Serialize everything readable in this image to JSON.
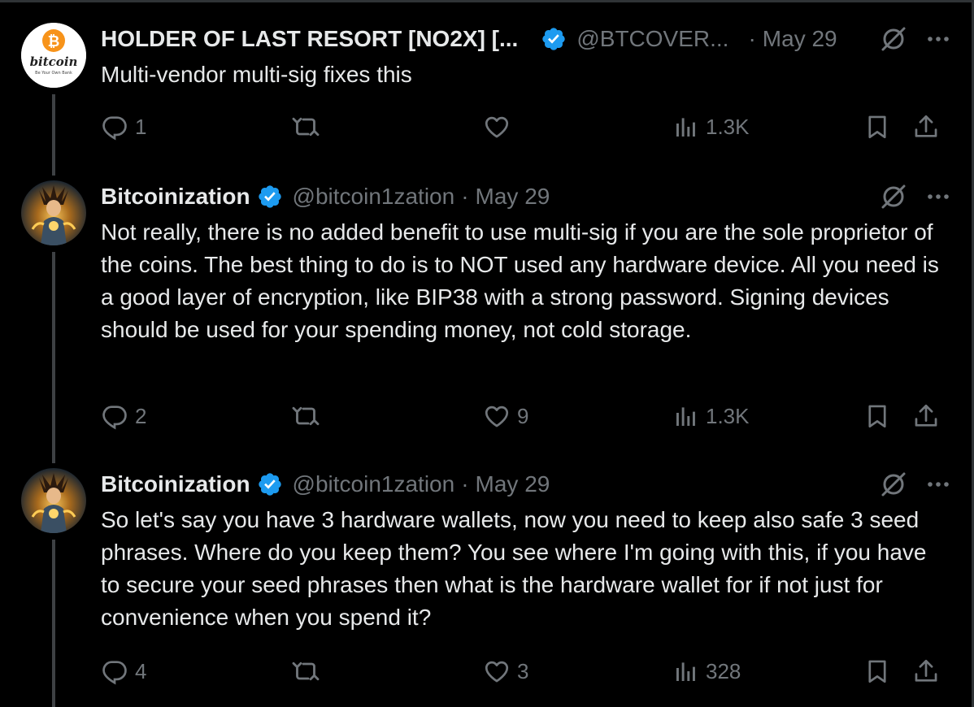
{
  "tweets": [
    {
      "avatar": "bitcoin-be-your-own-bank-logo",
      "avatar_text": "bitcoin",
      "avatar_subtext": "Be Your Own Bank",
      "name": "HOLDER OF LAST RESORT [NO2X] [...",
      "verified": true,
      "handle": "@BTCOVER...",
      "dot": "·",
      "date": "May 29",
      "text": "Multi-vendor multi-sig fixes this",
      "replies": "1",
      "reposts": "",
      "likes": "",
      "views": "1.3K"
    },
    {
      "avatar": "anime-character-avatar",
      "name": "Bitcoinization",
      "verified": true,
      "handle": "@bitcoin1zation",
      "dot": "·",
      "date": "May 29",
      "text": "Not really, there is no added benefit to use multi-sig if you are the sole proprietor of the coins. The best thing to do is to NOT used any hardware device. All you need is a good layer of encryption, like BIP38 with a strong password. Signing devices should be used for your spending money, not cold storage.",
      "replies": "2",
      "reposts": "",
      "likes": "9",
      "views": "1.3K"
    },
    {
      "avatar": "anime-character-avatar",
      "name": "Bitcoinization",
      "verified": true,
      "handle": "@bitcoin1zation",
      "dot": "·",
      "date": "May 29",
      "text": "So let's say you have 3 hardware wallets, now you need to keep also safe 3 seed phrases. Where do you keep them? You see where I'm going with this, if you have to secure your seed phrases then what is the hardware wallet for if not just for convenience when you spend it?",
      "replies": "4",
      "reposts": "",
      "likes": "3",
      "views": "328"
    }
  ],
  "icons": {
    "reply": "reply-icon",
    "repost": "repost-icon",
    "like": "like-icon",
    "views": "views-icon",
    "bookmark": "bookmark-icon",
    "share": "share-icon",
    "grok": "grok-icon",
    "more": "more-icon",
    "verified": "verified-badge-icon"
  },
  "colors": {
    "background": "#000000",
    "text": "#e7e9ea",
    "muted": "#71767b",
    "verified": "#1d9bf0",
    "bitcoin_orange": "#f7931a",
    "thread_line": "#3e4144"
  }
}
